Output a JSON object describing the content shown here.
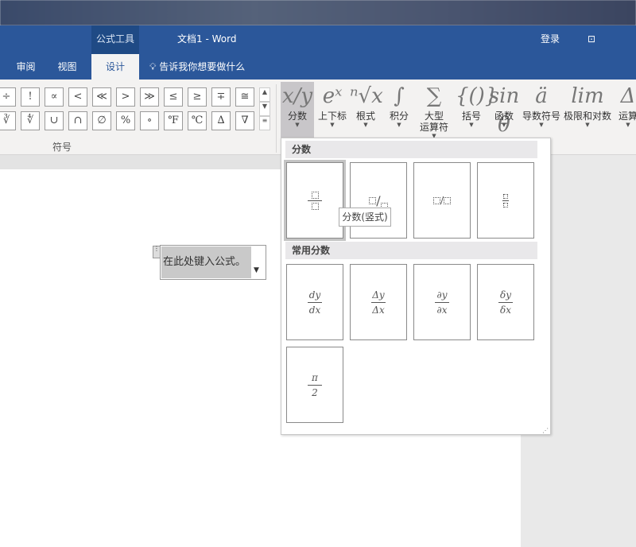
{
  "title_bar": {
    "context_tab": "公式工具",
    "document_title": "文档1  -  Word",
    "sign_in": "登录",
    "restore_icon": "ribbon-display-icon"
  },
  "tabs": [
    {
      "label": "审阅"
    },
    {
      "label": "视图"
    },
    {
      "label": "设计",
      "active": true
    }
  ],
  "tell_me": {
    "icon": "lightbulb-icon",
    "placeholder": "告诉我你想要做什么"
  },
  "symbols": {
    "row1": [
      "÷",
      "!",
      "∝",
      "<",
      "≪",
      ">",
      "≫",
      "≤",
      "≥",
      "∓",
      "≅"
    ],
    "row2": [
      "∛",
      "∜",
      "∪",
      "∩",
      "∅",
      "%",
      "∘",
      "℉",
      "℃",
      "∆",
      "∇"
    ],
    "group_label": "符号"
  },
  "structures": [
    {
      "icon": "x/y",
      "label": "分数",
      "active": true
    },
    {
      "icon": "eˣ",
      "label": "上下标"
    },
    {
      "icon": "ⁿ√x",
      "label": "根式"
    },
    {
      "icon": "∫",
      "label": "积分"
    },
    {
      "icon": "∑",
      "label": "大型\n运算符"
    },
    {
      "icon": "{()}",
      "label": "括号"
    },
    {
      "icon": "sin θ",
      "label": "函数"
    },
    {
      "icon": "ä",
      "label": "导数符号"
    },
    {
      "icon": "lim",
      "label": "极限和对数"
    },
    {
      "icon": "Δ",
      "label": "运算"
    }
  ],
  "dropdown": {
    "section1": "分数",
    "section2": "常用分数",
    "tooltip": "分数(竖式)",
    "common": [
      {
        "num": "dy",
        "den": "dx"
      },
      {
        "num": "Δy",
        "den": "Δx"
      },
      {
        "num": "∂y",
        "den": "∂x"
      },
      {
        "num": "δy",
        "den": "δx"
      },
      {
        "num": "π",
        "den": "2"
      }
    ]
  },
  "equation": {
    "placeholder": "在此处键入公式。"
  },
  "colors": {
    "brand": "#2b579a",
    "ribbon": "#f3f2f1"
  }
}
